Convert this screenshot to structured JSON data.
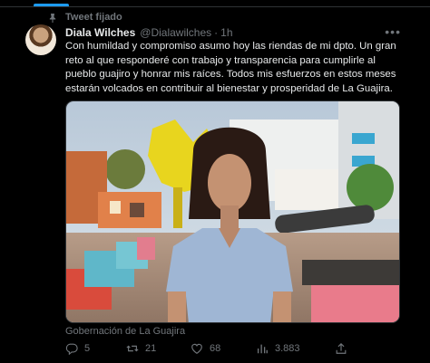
{
  "pinned": {
    "label": "Tweet fijado",
    "icon": "pin-icon"
  },
  "author": {
    "name": "Diala Wilches",
    "handle": "@Dialawilches",
    "time": "1h"
  },
  "tweet": {
    "text": "Con humildad y compromiso asumo hoy las riendas de mi dpto. Un gran reto al que responderé con trabajo y transparencia para cumplirle al pueblo guajiro y honrar mis raíces. Todos mis esfuerzos en estos meses estarán volcados en contribuir al bienestar y prosperidad de La Guajira.",
    "media_caption": "Gobernación de La Guajira"
  },
  "actions": {
    "replies": "5",
    "retweets": "21",
    "likes": "68",
    "views": "3.883"
  },
  "colors": {
    "accent": "#1d9bf0",
    "background": "#000000",
    "muted": "#71767b",
    "text": "#e7e9ea"
  }
}
